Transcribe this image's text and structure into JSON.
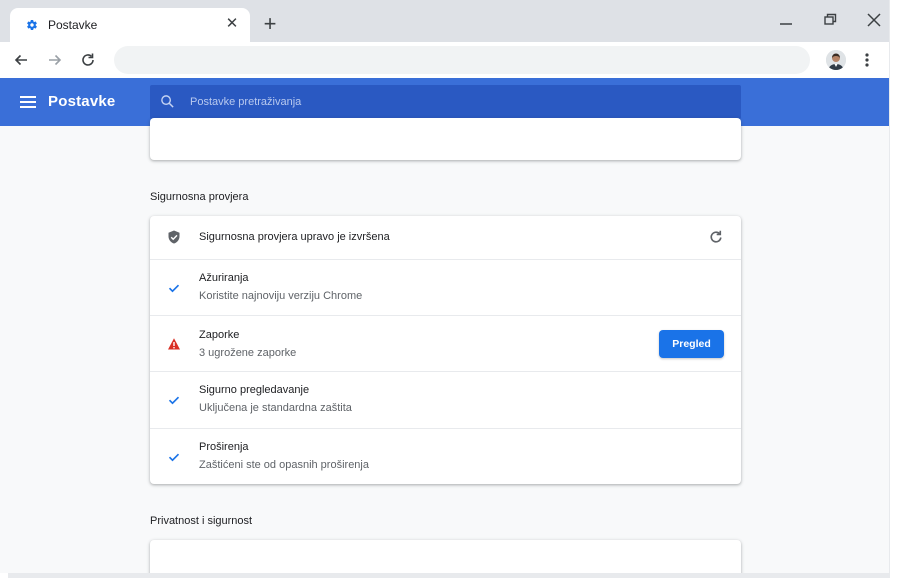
{
  "tab": {
    "title": "Postavke",
    "close_glyph": "✕",
    "new_tab_glyph": "+"
  },
  "settings": {
    "title": "Postavke",
    "search_placeholder": "Postavke pretraživanja"
  },
  "safety_section": {
    "title": "Sigurnosna provjera",
    "header": "Sigurnosna provjera upravo je izvršena",
    "items": [
      {
        "title": "Ažuriranja",
        "subtitle": "Koristite najnoviju verziju Chrome",
        "status": "ok",
        "icon": "check-icon"
      },
      {
        "title": "Zaporke",
        "subtitle": "3 ugrožene zaporke",
        "status": "warning",
        "icon": "warning-icon",
        "button": "Pregled"
      },
      {
        "title": "Sigurno pregledavanje",
        "subtitle": "Uključena je standardna zaštita",
        "status": "ok",
        "icon": "check-icon"
      },
      {
        "title": "Proširenja",
        "subtitle": "Zaštićeni ste od opasnih proširenja",
        "status": "ok",
        "icon": "check-icon"
      }
    ]
  },
  "privacy_section": {
    "title": "Privatnost i sigurnost"
  },
  "colors": {
    "header_blue": "#3a6fd8",
    "search_blue": "#2a59c2",
    "accent": "#1a73e8",
    "warning": "#d93025"
  }
}
